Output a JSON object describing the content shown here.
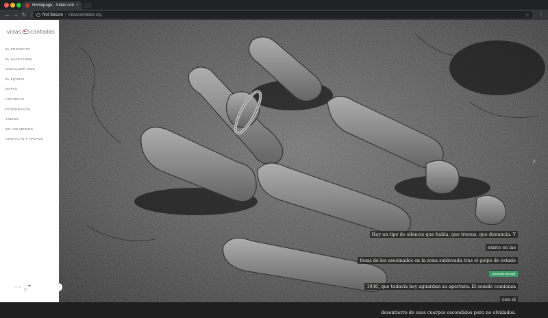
{
  "browser": {
    "tab_title": "Homepage - Vidas contadas",
    "tab_close": "×",
    "security_label": "Not Secure",
    "separator": "|",
    "url": "vidascontadas.org",
    "star_glyph": "☆",
    "menu_glyph": "⋮",
    "back_glyph": "←",
    "forward_glyph": "→",
    "reload_glyph": "↻",
    "home_glyph": "⌂"
  },
  "logo": {
    "left_word": "vidas",
    "right_word": "contadas"
  },
  "nav": {
    "items": [
      "El proyecto",
      "El hackathon",
      "Visualizar 2015",
      "El equipo",
      "Mapas",
      "Historias",
      "Fotografías",
      "Vídeos",
      "En los medios",
      "Contacto y apoyos"
    ]
  },
  "sidebar_footer": {
    "lang": "C | E",
    "more": "•••",
    "collapse_glyph": "‹"
  },
  "hero": {
    "next_glyph": "›",
    "caption_lines": [
      "Hay un tipo de silencio que habla, que truena, que denuncia. Y existe en las",
      "fosas de los asesinados en la zona sublevada tras el golpe de estado de julio de",
      "1936, que todavía hoy aguardan su apertura. El sonido comienza con el",
      "desentierro de esos cuerpos escondidos pero no olvidados."
    ],
    "credit": "Clemente Bernad"
  },
  "colors": {
    "accent": "#3e9b6a",
    "logo_red": "#c23b2e"
  }
}
